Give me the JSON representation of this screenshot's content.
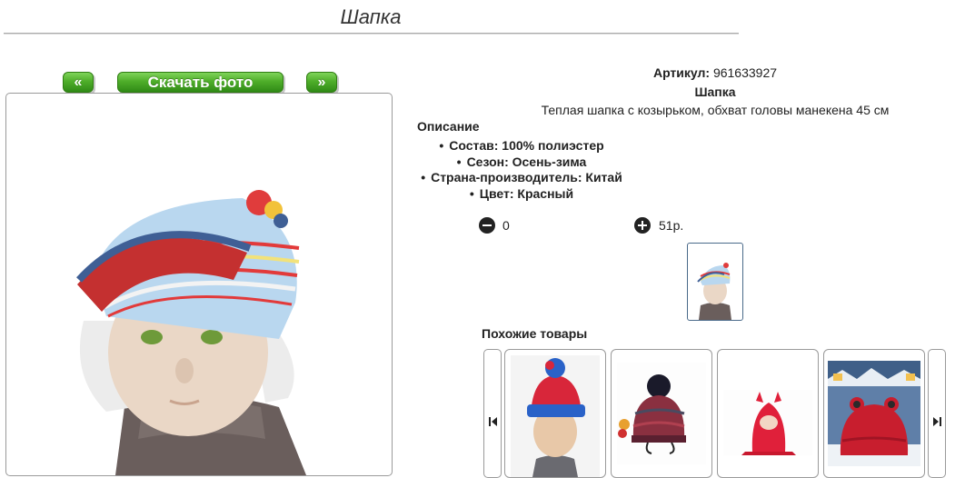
{
  "page": {
    "title": "Шапка"
  },
  "gallery": {
    "prev_label": "«",
    "download_label": "Скачать фото",
    "next_label": "»"
  },
  "product": {
    "article_label": "Артикул:",
    "article_value": "961633927",
    "name": "Шапка",
    "short_description": "Теплая шапка с козырьком, обхват головы манекена 45 см",
    "description_heading": "Описание",
    "features": [
      "Состав: 100% полиэстер",
      "Сезон: Осень-зима",
      "Страна-производитель: Китай",
      "Цвет: Красный"
    ],
    "quantity": "0",
    "price": "51р."
  },
  "similar": {
    "heading": "Похожие товары",
    "items": [
      {
        "icon": "red-blue-beanie-boy"
      },
      {
        "icon": "knitted-pompom-hat"
      },
      {
        "icon": "red-balaclava"
      },
      {
        "icon": "red-frog-hat"
      }
    ]
  },
  "colors": {
    "accent_green": "#4fae2a",
    "border_gray": "#9a9a9a"
  }
}
